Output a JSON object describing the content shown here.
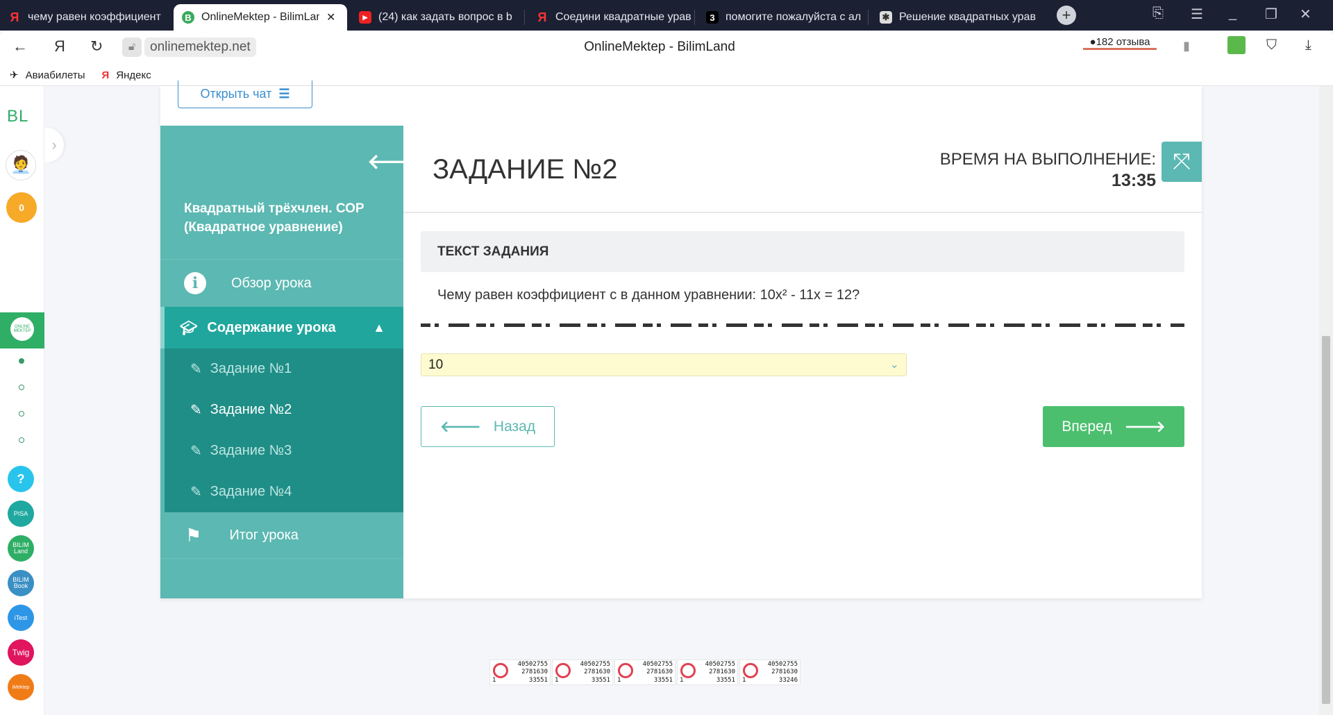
{
  "browser": {
    "tabs": [
      {
        "title": "чему равен коэффициент",
        "icon": "Я"
      },
      {
        "title": "OnlineMektep - BilimLand",
        "icon": "B",
        "active": true
      },
      {
        "title": "(24) как задать вопрос в b",
        "icon": "▶"
      },
      {
        "title": "Соедини квадратные урав",
        "icon": "Я"
      },
      {
        "title": "помогите пожалуйста с ал",
        "icon": "3"
      },
      {
        "title": "Решение квадратных урав",
        "icon": "✱"
      }
    ],
    "url": "onlinemektep.net",
    "page_title": "OnlineMektep - BilimLand",
    "reviews": "182 отзыва",
    "bookmarks": [
      {
        "label": "Авиабилеты"
      },
      {
        "label": "Яндекс"
      }
    ]
  },
  "leftbar": {
    "logo": "BL",
    "coins": "0",
    "apps": [
      "ONLINE MEKTEP",
      "?",
      "PISA",
      "BILIM Land",
      "BILIM Book",
      "iTest",
      "Twig",
      "iMektep"
    ]
  },
  "chat_button": "Открыть чат",
  "lesson": {
    "title": "Квадратный трёхчлен. СОР (Квадратное уравнение)",
    "overview": "Обзор урока",
    "contents": "Содержание урока",
    "tasks": [
      "Задание №1",
      "Задание №2",
      "Задание №3",
      "Задание №4"
    ],
    "summary": "Итог урока"
  },
  "task": {
    "title": "ЗАДАНИЕ №2",
    "timer_label": "ВРЕМЯ НА ВЫПОЛНЕНИЕ:",
    "timer": "13:35",
    "section_header": "ТЕКСТ ЗАДАНИЯ",
    "question": "Чему равен коэффициент с в данном уравнении: 10x² - 11x = 12?",
    "answer": "10",
    "back": "Назад",
    "forward": "Вперед"
  },
  "counters": [
    {
      "a": "40502755",
      "b": "2781630",
      "c": "33551",
      "d": "1"
    },
    {
      "a": "40502755",
      "b": "2781630",
      "c": "33551",
      "d": "1"
    },
    {
      "a": "40502755",
      "b": "2781630",
      "c": "33551",
      "d": "1"
    },
    {
      "a": "40502755",
      "b": "2781630",
      "c": "33551",
      "d": "1"
    },
    {
      "a": "40502755",
      "b": "2781630",
      "c": "33246",
      "d": "1"
    }
  ],
  "colors": {
    "teal": "#5cb8b2",
    "dark_teal": "#1f8e87",
    "green": "#4cbf6e"
  }
}
